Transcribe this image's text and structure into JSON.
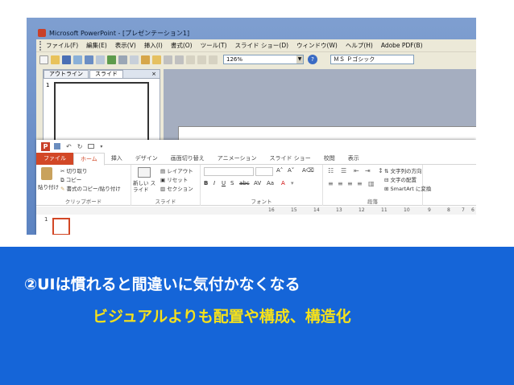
{
  "legacy": {
    "title": "Microsoft PowerPoint - [プレゼンテーション1]",
    "menu": [
      "ファイル(F)",
      "編集(E)",
      "表示(V)",
      "挿入(I)",
      "書式(O)",
      "ツール(T)",
      "スライド ショー(D)",
      "ウィンドウ(W)",
      "ヘルプ(H)",
      "Adobe PDF(B)"
    ],
    "zoom": "126%",
    "font": "ＭＳ Ｐゴシック",
    "panel_tabs": [
      "アウトライン",
      "スライド"
    ],
    "panel_close": "×",
    "slide_number": "1"
  },
  "modern": {
    "tabs": [
      "ファイル",
      "ホーム",
      "挿入",
      "デザイン",
      "画面切り替え",
      "アニメーション",
      "スライド ショー",
      "校閲",
      "表示"
    ],
    "clipboard": {
      "paste": "貼り付け",
      "cut": "切り取り",
      "copy": "コピー",
      "format_painter": "書式のコピー/貼り付け",
      "group": "クリップボード"
    },
    "slides": {
      "new_slide": "新しい スライド",
      "layout": "レイアウト",
      "reset": "リセット",
      "section": "セクション",
      "group": "スライド"
    },
    "font_group": "フォント",
    "paragraph_group": "段落",
    "text_direction": "文字列の方向",
    "align_text": "文字の配置",
    "smartart": "SmartArt に変換",
    "ruler": [
      "16",
      "15",
      "14",
      "13",
      "12",
      "11",
      "10",
      "9",
      "8",
      "7",
      "6"
    ],
    "slide_number": "1",
    "qat": [
      "↶",
      "↻"
    ]
  },
  "caption": {
    "line1": "②UIは慣れると間違いに気付かなくなる",
    "line2": "ビジュアルよりも配置や構成、構造化"
  },
  "colors": {
    "band": "#1565d8",
    "caption_line1": "#ffffff",
    "caption_line2": "#f6e11a",
    "accent": "#d24726"
  }
}
